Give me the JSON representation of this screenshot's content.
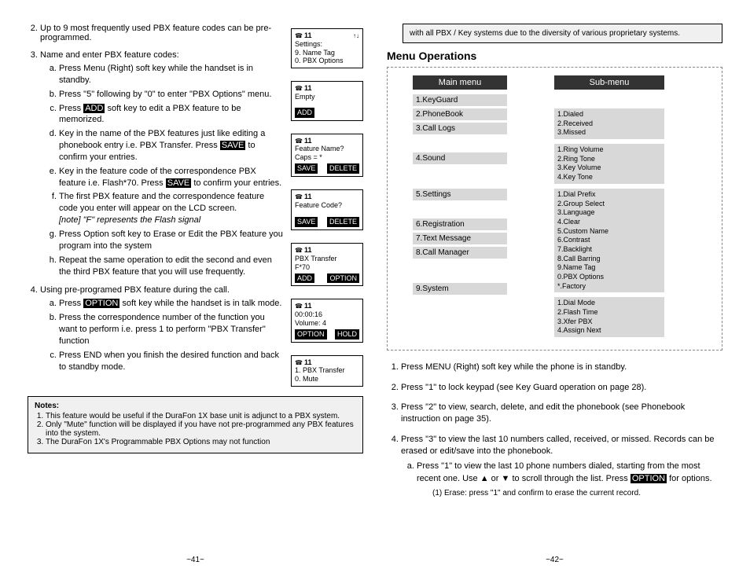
{
  "left": {
    "item2": "Up to 9 most frequently used PBX feature codes can be pre-programmed.",
    "item3": "Name and enter PBX feature codes:",
    "a": "Press Menu (Right) soft key while the handset is in standby.",
    "b": "Press \"5\"  following by \"0\" to enter \"PBX Options\" menu.",
    "c1": "Press ",
    "cBtn": "ADD",
    "c2": " soft key to edit a PBX feature to be memorized.",
    "d1": "Key in the name of the PBX features just like editing a phonebook entry i.e. PBX Transfer. Press ",
    "dBtn": "SAVE",
    "d2": " to confirm your entries.",
    "e1": "Key in the feature code of the correspondence PBX feature i.e. Flash*70. Press ",
    "eBtn": "SAVE",
    "e2": " to confirm your entries.",
    "f": "The first PBX feature and the correspondence feature code you enter will appear on the LCD screen.",
    "fnote": "[note] \"F\" represents the Flash signal",
    "g": " Press Option soft key to Erase or Edit the PBX feature you program into the system",
    "h": "Repeat the same operation to edit the second and even the third PBX feature that you will use frequently.",
    "item4": "Using pre-programed PBX feature during the call.",
    "a4_1": "Press ",
    "a4Btn": "OPTION",
    "a4_2": " soft key while the handset is in talk mode.",
    "b4": "Press the correspondence number of the function you want to perform i.e. press 1 to perform \"PBX Transfer\" function",
    "c4": "Press END when you finish the desired function and back to standby mode.",
    "notesTitle": "Notes:",
    "note1": "This feature would be useful if the DuraFon 1X base unit is adjunct to a PBX system.",
    "note2": "Only \"Mute\" function will be displayed if you have not pre-programmed any PBX features into the system.",
    "note3": "The DuraFon 1X's Programmable PBX Options may not function",
    "page": "~41~"
  },
  "lcd": {
    "l1": {
      "num": "11",
      "a": "Settings:",
      "b": "9. Name Tag",
      "c": "0. PBX Options"
    },
    "l2": {
      "num": "11",
      "a": "Empty",
      "btn": "ADD"
    },
    "l3": {
      "num": "11",
      "a": "Feature Name?",
      "b": "Caps = *",
      "s": "SAVE",
      "d": "DELETE"
    },
    "l4": {
      "num": "11",
      "a": "Feature Code?",
      "s": "SAVE",
      "d": "DELETE"
    },
    "l5": {
      "num": "11",
      "a": "PBX Transfer",
      "b": "F*70",
      "s": "ADD",
      "d": "OPTION"
    },
    "l6": {
      "num": "11",
      "a": "00:00:16",
      "b": "Volume: 4",
      "s": "OPTION",
      "d": "HOLD"
    },
    "l7": {
      "num": "11",
      "a": "1. PBX Transfer",
      "b": "0. Mute"
    }
  },
  "right": {
    "topnote": "with all PBX / Key systems due to the diversity of various proprietary systems.",
    "heading": "Menu Operations",
    "mainHeader": "Main menu",
    "subHeader": "Sub-menu",
    "mm": [
      "1.KeyGuard",
      "2.PhoneBook",
      "3.Call Logs",
      "4.Sound",
      "5.Settings",
      "6.Registration",
      "7.Text Message",
      "8.Call Manager",
      "9.System"
    ],
    "sg1": "1.Dialed\n2.Received\n3.Missed",
    "sg2": "1.Ring Volume\n2.Ring Tone\n3.Key Volume\n4.Key Tone",
    "sg3": "1.Dial Prefix\n2.Group Select\n3.Language\n4.Clear\n5.Custom Name\n6.Contrast\n7.Backlight\n8.Call Barring\n9.Name Tag\n0.PBX Options\n*.Factory",
    "sg4": "1.Dial Mode\n2.Flash Time\n3.Xfer PBX\n4.Assign Next",
    "s1": "Press MENU (Right) soft key while the phone is in standby.",
    "s2": "Press \"1\" to lock keypad (see Key Guard operation on page 28).",
    "s3": "Press \"2\" to view, search, delete, and edit the phonebook (see Phonebook instruction on page 35).",
    "s4": "Press \"3\" to view the last 10 numbers called, received, or missed. Records can be erased or edit/save into the phonebook.",
    "s4a_1": "Press \"1\" to view the last 10 phone numbers dialed, starting from the most recent one.  Use ",
    "s4a_up": "▲",
    "s4a_or": " or ",
    "s4a_dn": "▼",
    "s4a_2": " to scroll through the list. Press ",
    "s4aBtn": "OPTION",
    "s4a_3": " for options.",
    "s4a_sub": "(1)  Erase: press \"1\" and confirm to erase the current record.",
    "page": "~42~"
  }
}
